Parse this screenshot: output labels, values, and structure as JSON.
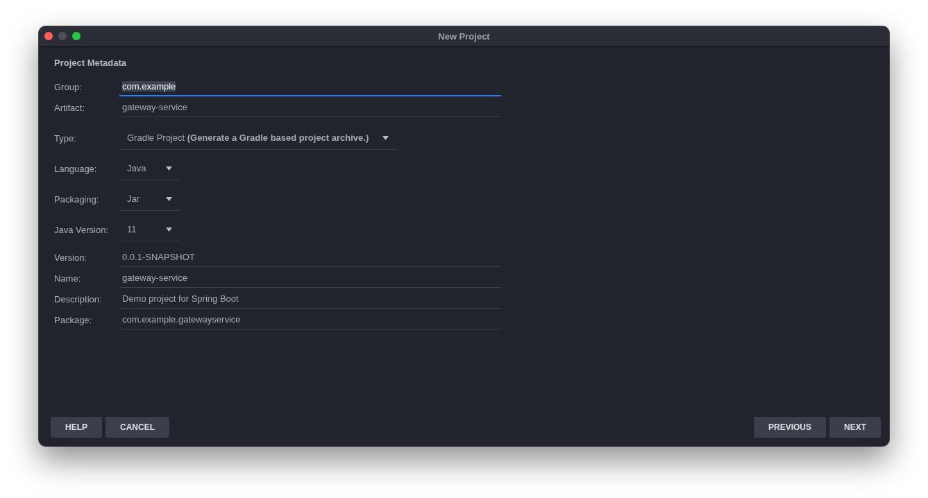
{
  "window": {
    "title": "New Project"
  },
  "section_title": "Project Metadata",
  "fields": [
    {
      "kind": "text",
      "label": "Group:",
      "value": "com.example",
      "focused": true
    },
    {
      "kind": "text",
      "label": "Artifact:",
      "value": "gateway-service",
      "focused": false
    },
    {
      "kind": "dropdown",
      "label": "Type:",
      "value": "Gradle Project **(Generate a Gradle based project archive.)**",
      "focused": false
    },
    {
      "kind": "dropdown",
      "label": "Language:",
      "value": "Java",
      "focused": false
    },
    {
      "kind": "dropdown",
      "label": "Packaging:",
      "value": "Jar",
      "focused": false
    },
    {
      "kind": "dropdown",
      "label": "Java Version:",
      "value": "11",
      "focused": false
    },
    {
      "kind": "text",
      "label": "Version:",
      "value": "0.0.1-SNAPSHOT",
      "focused": false
    },
    {
      "kind": "text",
      "label": "Name:",
      "value": "gateway-service",
      "focused": false
    },
    {
      "kind": "text",
      "label": "Description:",
      "value": "Demo project for Spring Boot",
      "focused": false
    },
    {
      "kind": "text",
      "label": "Package:",
      "value": "com.example.gatewayservice",
      "focused": false
    }
  ],
  "buttons_left": [
    "HELP",
    "CANCEL"
  ],
  "buttons_right": [
    "PREVIOUS",
    "NEXT"
  ]
}
